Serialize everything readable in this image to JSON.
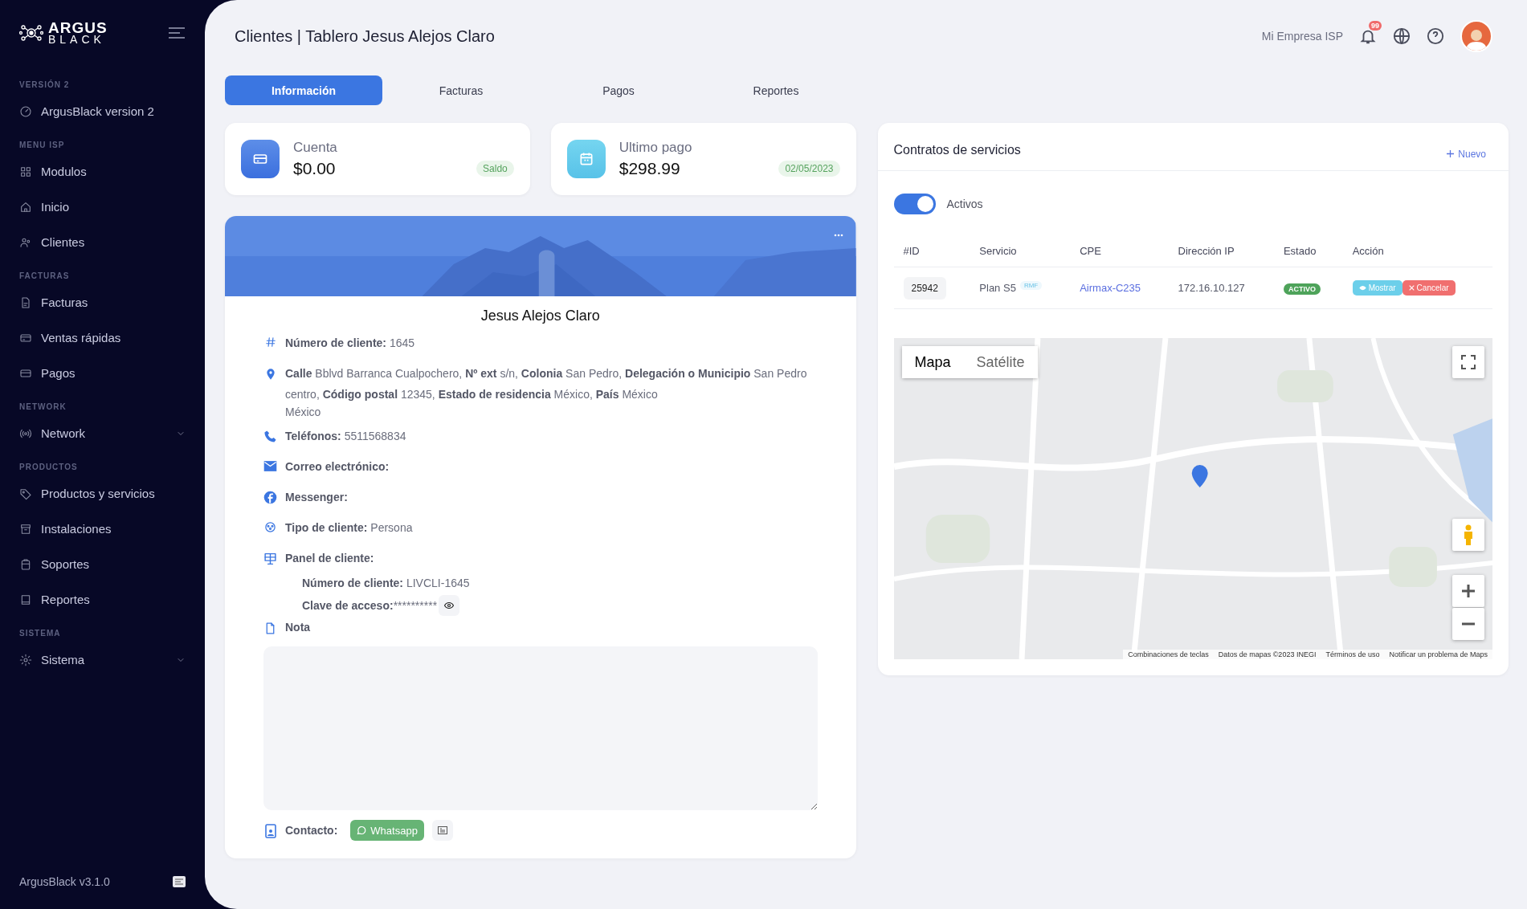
{
  "brand": {
    "line_1": "ARGUS",
    "line_2": "BLACK"
  },
  "sidebar": {
    "sections": [
      {
        "title": "VERSIÓN 2",
        "items": [
          {
            "label": "ArgusBlack version 2",
            "kind": "link"
          }
        ]
      },
      {
        "title": "MENU ISP",
        "items": [
          {
            "label": "Modulos",
            "kind": "link"
          },
          {
            "label": "Inicio",
            "kind": "link"
          },
          {
            "label": "Clientes",
            "kind": "link"
          }
        ]
      },
      {
        "title": "FACTURAS",
        "items": [
          {
            "label": "Facturas",
            "kind": "link"
          },
          {
            "label": "Ventas rápidas",
            "kind": "link"
          },
          {
            "label": "Pagos",
            "kind": "link"
          }
        ]
      },
      {
        "title": "NETWORK",
        "items": [
          {
            "label": "Network",
            "kind": "group"
          }
        ]
      },
      {
        "title": "PRODUCTOS",
        "items": [
          {
            "label": "Productos y servicios",
            "kind": "link"
          },
          {
            "label": "Instalaciones",
            "kind": "link"
          },
          {
            "label": "Soportes",
            "kind": "link"
          },
          {
            "label": "Reportes",
            "kind": "link"
          }
        ]
      },
      {
        "title": "SISTEMA",
        "items": [
          {
            "label": "Sistema",
            "kind": "group"
          }
        ]
      }
    ],
    "footer": "ArgusBlack v3.1.0"
  },
  "header": {
    "title": "Clientes | Tablero Jesus Alejos Claro",
    "company": "Mi Empresa ISP",
    "notifications": "99"
  },
  "tabs": [
    {
      "label": "Información",
      "selected": true
    },
    {
      "label": "Facturas",
      "selected": false
    },
    {
      "label": "Pagos",
      "selected": false
    },
    {
      "label": "Reportes",
      "selected": false
    }
  ],
  "account_cards": [
    {
      "kind": "account",
      "title": "Cuenta",
      "amount": "$0.00",
      "badge": "Saldo"
    },
    {
      "kind": "payment",
      "title": "Ultimo pago",
      "amount": "$298.99",
      "badge": "02/05/2023"
    }
  ],
  "profile": {
    "name": "Jesus Alejos Claro",
    "fields": [
      {
        "kind": "line",
        "text": "**Número de cliente:** 1645"
      },
      {
        "kind": "line",
        "text": "**Calle** Bblvd Barranca Cualpochero, **Nº ext** s/n, **Colonia** San Pedro, **Delegación o Municipio** San Pedro centro, **Código postal** 12345, **Estado de residencia** México, **País** México",
        "extra": "México"
      },
      {
        "kind": "line",
        "text": "**Teléfonos:** 5511568834"
      },
      {
        "kind": "line",
        "text": "**Correo electrónico:**"
      },
      {
        "kind": "line",
        "text": "**Messenger:**"
      },
      {
        "kind": "line",
        "text": "**Tipo de cliente:** Persona"
      },
      {
        "kind": "panel",
        "text": "**Panel de cliente:**",
        "client_number": "**Número de cliente:** LIVCLI-1645",
        "password_label": "Clave de acceso:",
        "password": "**********"
      }
    ],
    "note_label": "Nota",
    "contact_label": "Contacto:",
    "whatsapp": "Whatsapp"
  },
  "contracts": {
    "title": "Contratos de servicios",
    "new": "Nuevo",
    "toggle": {
      "label": "Activos",
      "on": true
    },
    "columns": [
      "#ID",
      "Servicio",
      "CPE",
      "Dirección IP",
      "Estado",
      "Acción"
    ],
    "rows": [
      {
        "id": "25942",
        "service": "Plan S5",
        "tag": "RMF",
        "cpe": "Airmax-C235",
        "ip": "172.16.10.127",
        "status": "ACTIVO",
        "actions": [
          "Mostrar",
          "Cancelar"
        ]
      }
    ]
  },
  "map": {
    "types": [
      {
        "label": "Mapa",
        "selected": true
      },
      {
        "label": "Satélite",
        "selected": false
      }
    ],
    "footer": [
      "Combinaciones de teclas",
      "Datos de mapas ©2023 INEGI",
      "Términos de uso",
      "Notificar un problema de Maps"
    ]
  }
}
